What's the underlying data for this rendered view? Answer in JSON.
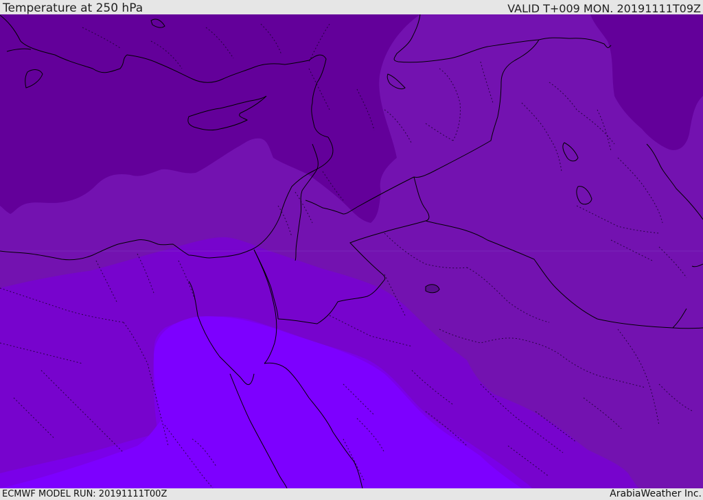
{
  "header": {
    "title": "Temperature at 250 hPa",
    "valid": "VALID T+009 MON. 20191111T09Z"
  },
  "footer": {
    "model_run": "ECMWF MODEL RUN: 20191111T00Z",
    "brand": "ArabiaWeather Inc."
  },
  "colors": {
    "band_coldest": "#63009a",
    "band_cold": "#7312b0",
    "band_mid": "#7704cd",
    "band_warm": "#7a00e8",
    "band_warmest": "#7d00ff",
    "coastline": "#000000"
  }
}
